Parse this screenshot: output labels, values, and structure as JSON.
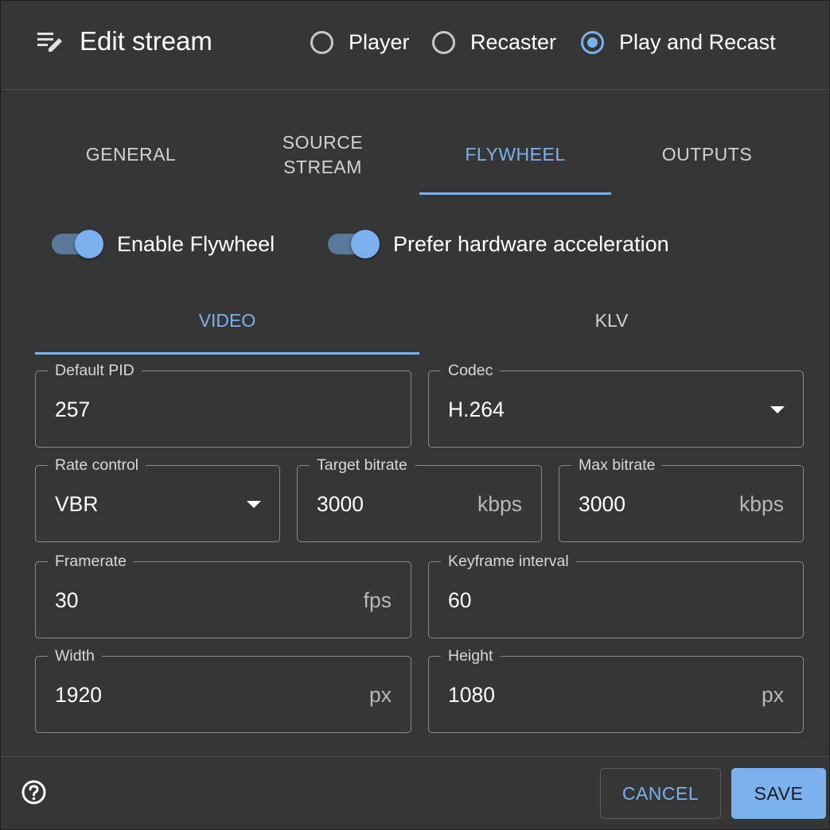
{
  "header": {
    "title": "Edit stream",
    "mode_options": [
      {
        "label": "Player",
        "checked": false
      },
      {
        "label": "Recaster",
        "checked": false
      },
      {
        "label": "Play and Recast",
        "checked": true
      }
    ]
  },
  "tabs": [
    {
      "label": "GENERAL",
      "active": false
    },
    {
      "label": "SOURCE STREAM",
      "active": false
    },
    {
      "label": "FLYWHEEL",
      "active": true
    },
    {
      "label": "OUTPUTS",
      "active": false
    }
  ],
  "toggles": [
    {
      "label": "Enable Flywheel",
      "on": true
    },
    {
      "label": "Prefer hardware acceleration",
      "on": true
    }
  ],
  "subtabs": [
    {
      "label": "VIDEO",
      "active": true
    },
    {
      "label": "KLV",
      "active": false
    }
  ],
  "fields": {
    "default_pid": {
      "label": "Default PID",
      "value": "257"
    },
    "codec": {
      "label": "Codec",
      "value": "H.264"
    },
    "rate_control": {
      "label": "Rate control",
      "value": "VBR"
    },
    "target_bitrate": {
      "label": "Target bitrate",
      "value": "3000",
      "suffix": "kbps"
    },
    "max_bitrate": {
      "label": "Max bitrate",
      "value": "3000",
      "suffix": "kbps"
    },
    "framerate": {
      "label": "Framerate",
      "value": "30",
      "suffix": "fps"
    },
    "keyframe_interval": {
      "label": "Keyframe interval",
      "value": "60"
    },
    "width": {
      "label": "Width",
      "value": "1920",
      "suffix": "px"
    },
    "height": {
      "label": "Height",
      "value": "1080",
      "suffix": "px"
    }
  },
  "footer": {
    "cancel_label": "CANCEL",
    "save_label": "SAVE"
  },
  "colors": {
    "accent": "#7ab1ee",
    "background": "#363636",
    "border": "#8a8a8a"
  },
  "icons": {
    "title_icon": "edit-list-icon",
    "help_icon": "help-circle-icon"
  }
}
